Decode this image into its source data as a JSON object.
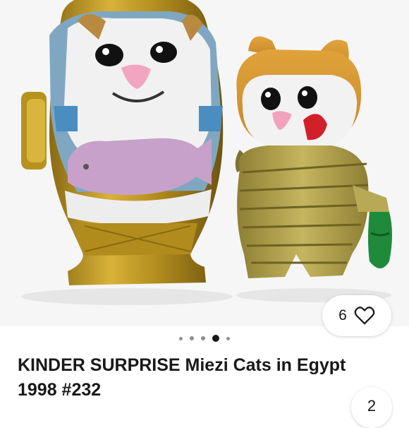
{
  "listing": {
    "title": "KINDER SURPRISE Miezi Cats in Egypt 1998 #232",
    "like_count": "6",
    "gallery": {
      "total_images": 5,
      "active_index": 3
    },
    "partial_button_label": "2",
    "icons": [
      "heart-icon"
    ],
    "colors": {
      "text": "#191919",
      "dot_inactive": "#8f8f8f",
      "background": "#ffffff"
    }
  }
}
